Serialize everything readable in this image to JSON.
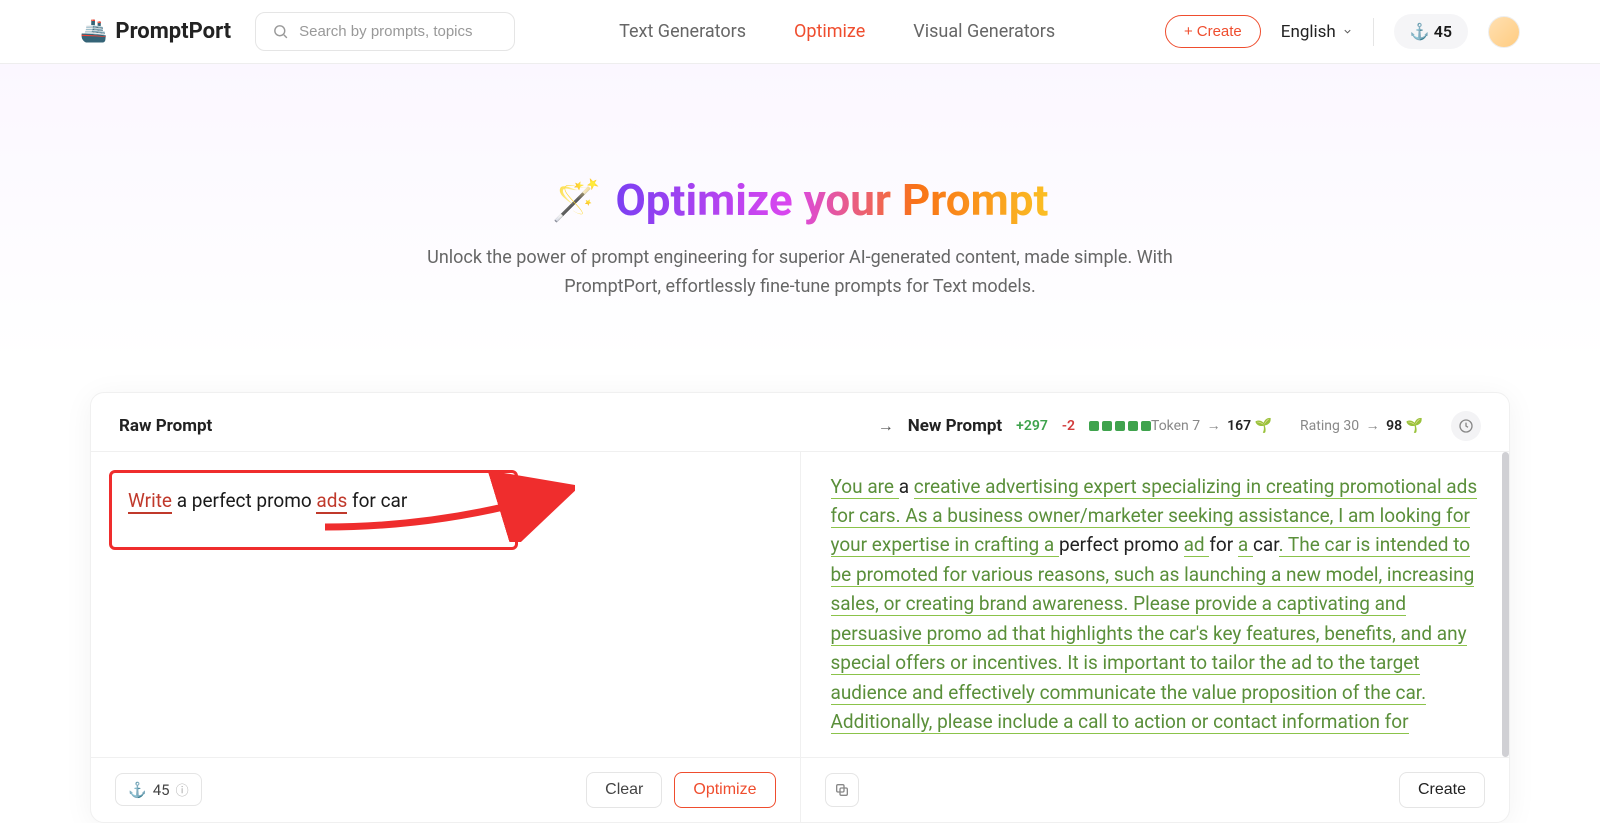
{
  "header": {
    "brand": "PromptPort",
    "search_placeholder": "Search by prompts, topics",
    "nav": {
      "text_generators": "Text Generators",
      "optimize": "Optimize",
      "visual_generators": "Visual Generators"
    },
    "create_label": "Create",
    "language": "English",
    "credits": "45"
  },
  "hero": {
    "title": "Optimize your Prompt",
    "subtitle": "Unlock the power of prompt engineering for superior AI-generated content, made simple. With PromptPort, effortlessly fine-tune prompts for Text models."
  },
  "card": {
    "raw_title": "Raw Prompt",
    "new_title": "New Prompt",
    "delta_plus": "+297",
    "delta_neg": "-2",
    "token_label": "Token",
    "token_from": "7",
    "token_to": "167",
    "rating_label": "Rating",
    "rating_from": "30",
    "rating_to": "98",
    "raw_segments": {
      "write": "Write",
      "mid": " a perfect promo ",
      "ads": "ads",
      "end": " for car"
    },
    "new_segments": {
      "s1": "You are ",
      "a": "a ",
      "s2": "creative advertising expert specializing in creating promotional ads for cars. As a business owner/marketer seeking assistance, I am looking for your expertise in crafting a ",
      "k1": "perfect promo ",
      "s3": "ad ",
      "k2": "for ",
      "s4": "a ",
      "k3": "car",
      "s5": ". The car is intended to be promoted for various reasons, such as launching a new model, increasing sales, or creating brand awareness. Please provide a captivating and persuasive promo ad that highlights the car's key features, benefits, and any special offers or incentives. It is important to tailor the ad to the target audience and effectively communicate the value proposition of the car. Additionally, please include a call to action or contact information for"
    },
    "footer": {
      "cost": "45",
      "clear": "Clear",
      "optimize": "Optimize",
      "create": "Create"
    }
  }
}
